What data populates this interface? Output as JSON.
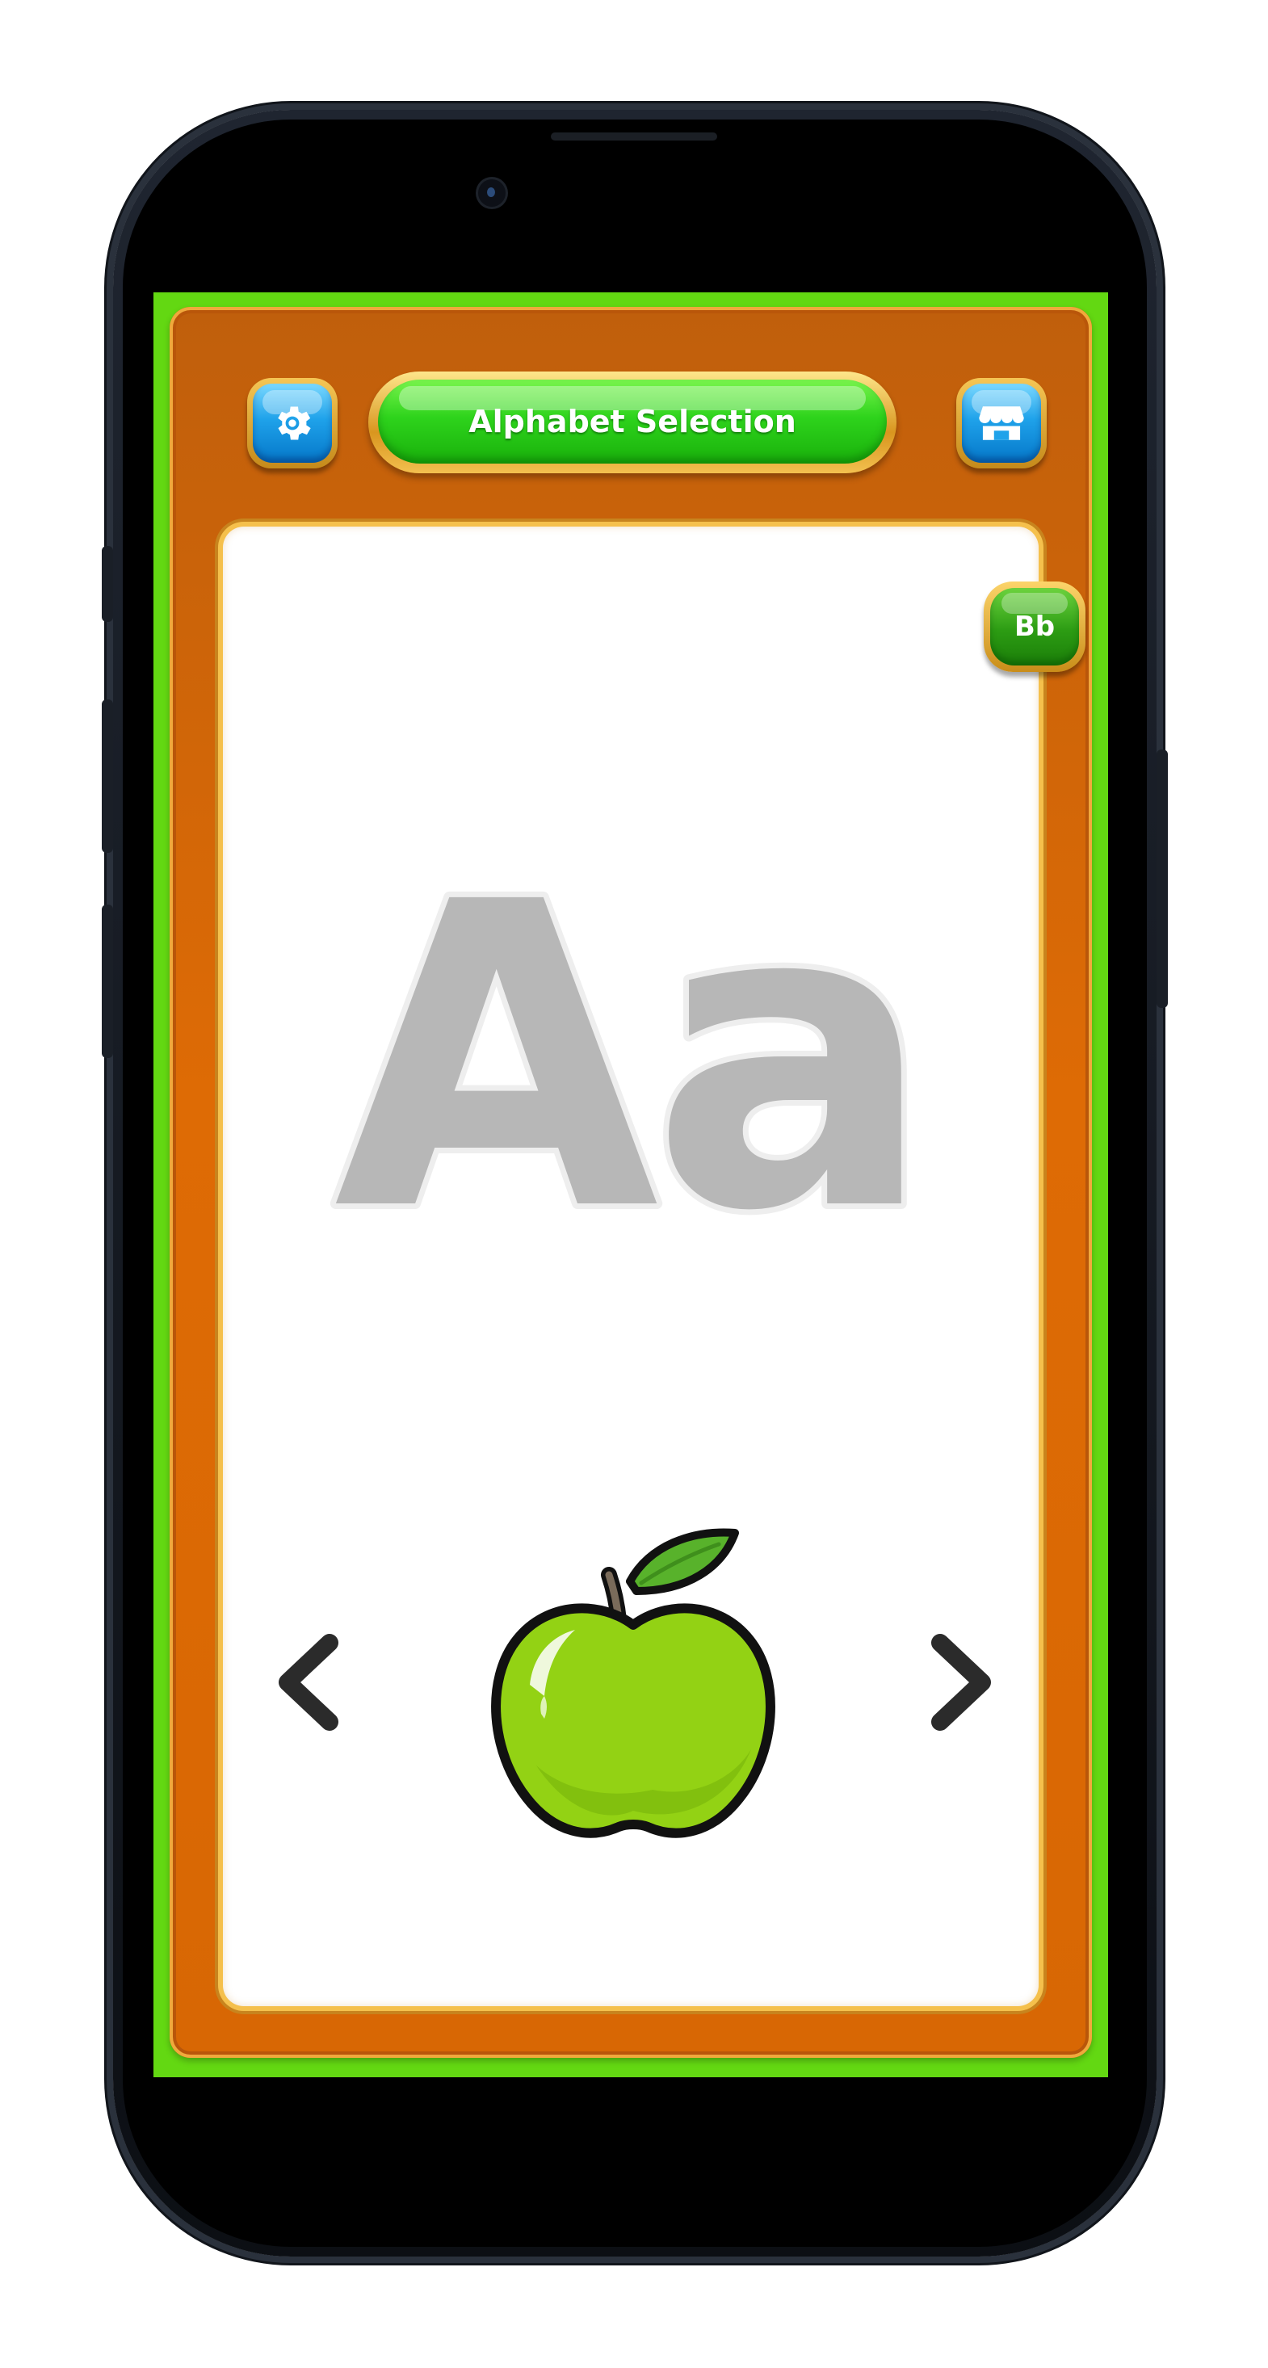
{
  "header": {
    "title": "Alphabet Selection",
    "settings_icon": "gear-icon",
    "shop_icon": "shop-icon"
  },
  "card": {
    "letter_display": "Aa",
    "next_letter_label": "Bb",
    "picture_icon": "green-apple-icon",
    "prev_icon": "chevron-left-icon",
    "next_icon": "chevron-right-icon"
  },
  "colors": {
    "screen_background": "#63d812",
    "frame_orange": "#de6b05",
    "frame_gold": "#f5c04c",
    "title_green": "#2ed31c",
    "button_blue": "#1fa2ea",
    "letter_gray": "#b7b7b7",
    "apple_green": "#93d214"
  }
}
